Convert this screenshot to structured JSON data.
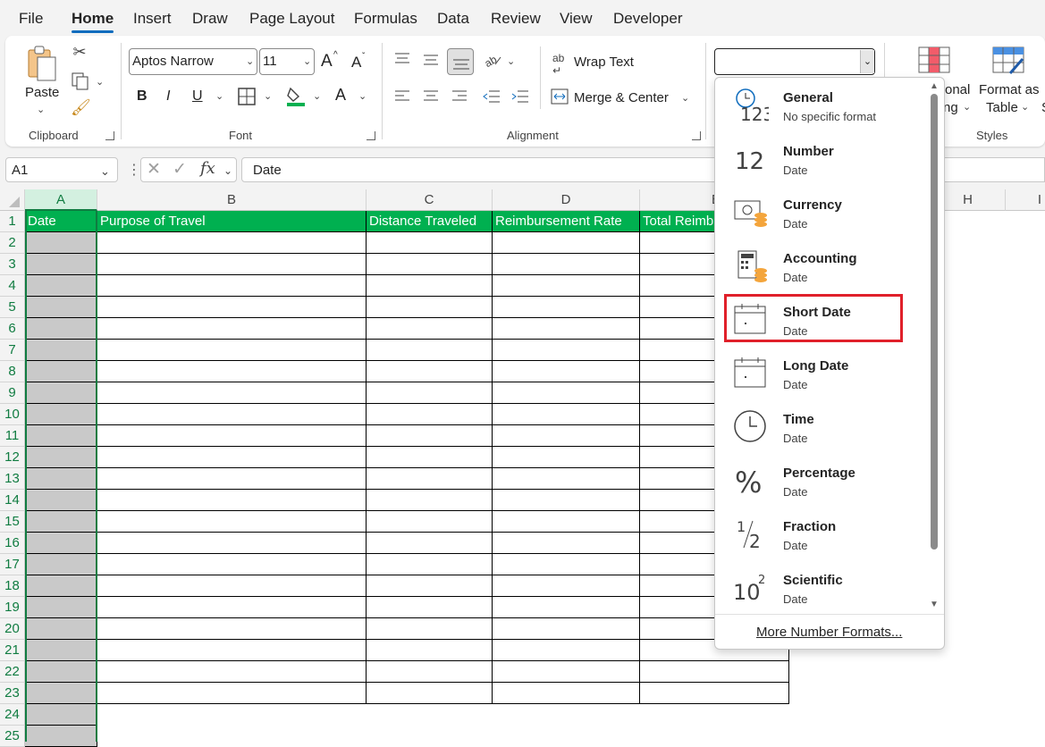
{
  "menu": {
    "items": [
      "File",
      "Home",
      "Insert",
      "Draw",
      "Page Layout",
      "Formulas",
      "Data",
      "Review",
      "View",
      "Developer"
    ],
    "active": "Home"
  },
  "ribbon": {
    "clipboard": {
      "paste_label": "Paste",
      "group_label": "Clipboard"
    },
    "font": {
      "font_name": "Aptos Narrow",
      "font_size": "11",
      "bold": "B",
      "italic": "I",
      "underline": "U",
      "grow": "A",
      "shrink": "A",
      "font_color": "A",
      "group_label": "Font"
    },
    "alignment": {
      "wrap_text": "Wrap Text",
      "merge_center": "Merge & Center",
      "group_label": "Alignment"
    },
    "number": {
      "format_value": ""
    },
    "styles": {
      "cond_line1": "onal",
      "cond_line2": "ng",
      "format_table_line1": "Format as",
      "format_table_line2": "Table",
      "group_label": "Styles",
      "partial_s": "S"
    }
  },
  "formula_bar": {
    "name_box": "A1",
    "fx": "fx",
    "content": "Date"
  },
  "grid": {
    "columns": [
      "A",
      "B",
      "C",
      "D",
      "E",
      "H",
      "I"
    ],
    "header_row": [
      "Date",
      "Purpose of Travel",
      "Distance Traveled",
      "Reimbursement Rate",
      "Total Reimb"
    ],
    "rows": [
      "1",
      "2",
      "3",
      "4",
      "5",
      "6",
      "7",
      "8",
      "9",
      "10",
      "11",
      "12",
      "13",
      "14",
      "15",
      "16",
      "17",
      "18",
      "19",
      "20",
      "21",
      "22",
      "23",
      "24",
      "25"
    ]
  },
  "colors": {
    "accent": "#0f6cbd",
    "excel_green": "#107c41",
    "header_fill": "#00b050",
    "selection_fill": "#c9c9c9",
    "highlight_box": "#e0202a"
  },
  "number_format_dropdown": {
    "items": [
      {
        "title": "General",
        "sub": "No specific format",
        "icon": "clock-123-icon"
      },
      {
        "title": "Number",
        "sub": "Date",
        "icon": "number-12-icon"
      },
      {
        "title": "Currency",
        "sub": "Date",
        "icon": "currency-icon"
      },
      {
        "title": "Accounting",
        "sub": "Date",
        "icon": "accounting-icon"
      },
      {
        "title": "Short Date",
        "sub": "Date",
        "icon": "calendar-icon"
      },
      {
        "title": "Long Date",
        "sub": "Date",
        "icon": "calendar-icon"
      },
      {
        "title": "Time",
        "sub": "Date",
        "icon": "clock-icon"
      },
      {
        "title": "Percentage",
        "sub": "Date",
        "icon": "percent-icon"
      },
      {
        "title": "Fraction",
        "sub": "Date",
        "icon": "fraction-icon"
      },
      {
        "title": "Scientific",
        "sub": "Date",
        "icon": "scientific-icon"
      }
    ],
    "highlighted": "Short Date",
    "more": "More Number Formats...",
    "icon_text": {
      "num12": "12",
      "sci_base": "10",
      "sci_exp": "2",
      "frac_num": "1",
      "frac_den": "2",
      "pct": "%",
      "gen_123": "123"
    }
  }
}
